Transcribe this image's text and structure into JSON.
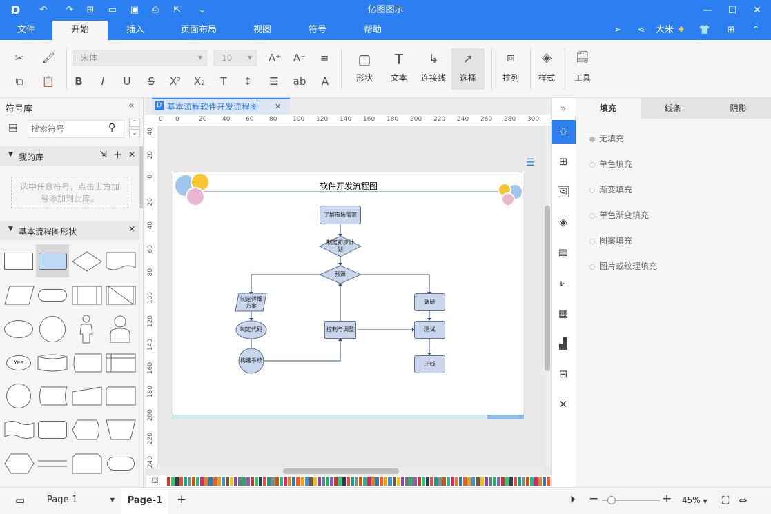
{
  "app": {
    "title": "亿图图示"
  },
  "menu": {
    "tabs": [
      "文件",
      "开始",
      "插入",
      "页面布局",
      "视图",
      "符号",
      "帮助"
    ],
    "active": "开始",
    "user": "大米"
  },
  "ribbon": {
    "font_family": "宋体",
    "font_size": "10",
    "tools": {
      "shape": "形状",
      "text": "文本",
      "connector": "连接线",
      "select": "选择",
      "arrange": "排列",
      "style": "样式",
      "tools": "工具"
    }
  },
  "library": {
    "title": "符号库",
    "search_placeholder": "搜索符号",
    "my_library": "我的库",
    "my_library_hint": "选中任意符号，点击上方加号添加到此库。",
    "basic_shapes": "基本流程图形状",
    "yes_label": "Yes"
  },
  "document": {
    "tab_title": "基本流程软件开发流程图",
    "diagram_title": "软件开发流程图"
  },
  "rulers": {
    "h": [
      "0",
      "0",
      "20",
      "40",
      "60",
      "80",
      "100",
      "120",
      "140",
      "160",
      "180",
      "200",
      "220",
      "240",
      "260",
      "280",
      "300"
    ],
    "v": [
      "40",
      "20",
      "0",
      "20",
      "40",
      "60",
      "80",
      "100",
      "120",
      "140",
      "160",
      "180",
      "200",
      "220",
      "240"
    ]
  },
  "flowchart": {
    "nodes": {
      "market": "了解市场需求",
      "plan": "制定初步计划",
      "budget": "预算",
      "detail": "制定详细方案",
      "code": "制定代码",
      "build": "构建系统",
      "control": "控制与调整",
      "research": "调研",
      "test": "测试",
      "launch": "上线"
    }
  },
  "fill_panel": {
    "tabs": [
      "填充",
      "线条",
      "阴影"
    ],
    "active": "填充",
    "options": [
      "无填充",
      "单色填充",
      "渐变填充",
      "单色渐变填充",
      "图案填充",
      "图片或纹理填充"
    ],
    "selected": "无填充"
  },
  "status": {
    "page_dropdown": "Page-1",
    "page_tab": "Page-1",
    "zoom": "45%",
    "zoom_fraction": 0.1
  },
  "colors": {
    "accent": "#2b7ff0",
    "node_fill": "#c9d6ec",
    "node_border": "#5a6f99"
  }
}
